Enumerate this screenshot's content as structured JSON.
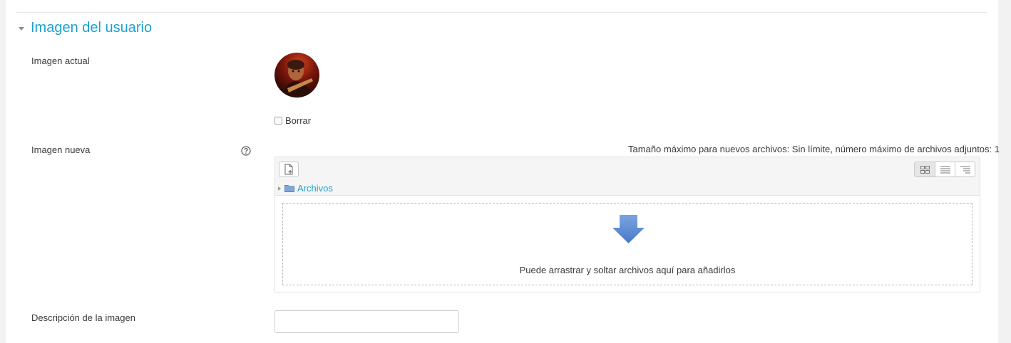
{
  "section": {
    "title": "Imagen del usuario"
  },
  "current_image": {
    "label": "Imagen actual",
    "delete_label": "Borrar",
    "delete_checked": false
  },
  "new_image": {
    "label": "Imagen nueva",
    "help_icon": "question-circle-icon",
    "limits_text": "Tamaño máximo para nuevos archivos: Sin límite, número máximo de archivos adjuntos: 1",
    "add_file_icon": "add-file-icon",
    "view_buttons": [
      "grid-view-icon",
      "list-view-icon",
      "tree-view-icon"
    ],
    "breadcrumb_folder": "Archivos",
    "drop_text": "Puede arrastrar y soltar archivos aquí para añadirlos"
  },
  "image_description": {
    "label": "Descripción de la imagen",
    "value": "",
    "placeholder": ""
  },
  "colors": {
    "accent": "#1ca0d3",
    "drop_arrow": "#5b8fd6"
  }
}
